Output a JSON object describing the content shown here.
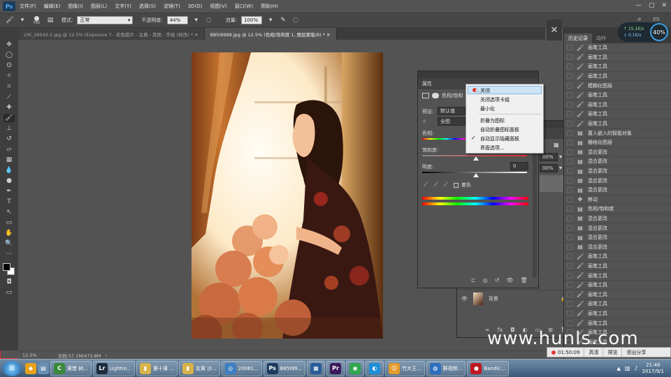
{
  "app": {
    "logo": "Ps",
    "menus": [
      "文件(F)",
      "编辑(E)",
      "图像(I)",
      "图层(L)",
      "文字(Y)",
      "选择(S)",
      "滤镜(T)",
      "3D(D)",
      "视图(V)",
      "窗口(W)",
      "帮助(H)"
    ],
    "window_controls": [
      "—",
      "▢",
      "✕"
    ]
  },
  "options": {
    "brush_size": "700",
    "mode_label": "模式:",
    "mode_value": "正常",
    "opacity_label": "不透明度:",
    "opacity_value": "44%",
    "flow_label": "流量:",
    "flow_value": "100%"
  },
  "tabs": [
    {
      "label": "LYK_29542-2.jpg @ 12.5% (Exposure 7 - 彩色胶片 - 古典 - 其他 - 手绘 (修改) * ✕",
      "active": false
    },
    {
      "label": "B85I9999.jpg @ 12.5% (色相/饱和度 1, 图层蒙版/8) * ✕",
      "active": true
    }
  ],
  "status": {
    "zoom": "12.5%",
    "doc": "文档:57.1M/473.8M"
  },
  "properties": {
    "tab": "属性",
    "adjust_title": "色相/饱和",
    "preset_label": "预设:",
    "preset_value": "默认值",
    "channel_value": "全图",
    "hue_label": "色相:",
    "saturation_label": "饱和度:",
    "lightness_label": "明度:",
    "lightness_value": "0",
    "colorize_label": "着色"
  },
  "context_menu": {
    "items": [
      "关闭",
      "关闭选项卡组",
      "最小化",
      "折叠为图标",
      "自动折叠图标面板",
      "自动显示隐藏面板",
      "界面选项..."
    ],
    "checked": "自动显示隐藏面板"
  },
  "layers": {
    "opacity_value": "00%",
    "fill_value": "00%",
    "background_layer": "背景"
  },
  "history": {
    "tabs": [
      "历史记录",
      "动作"
    ],
    "items": [
      {
        "icon": "brush",
        "label": "画笔工具"
      },
      {
        "icon": "brush",
        "label": "画笔工具"
      },
      {
        "icon": "brush",
        "label": "画笔工具"
      },
      {
        "icon": "brush",
        "label": "画笔工具"
      },
      {
        "icon": "brush",
        "label": "模糊化图层"
      },
      {
        "icon": "brush",
        "label": "画笔工具"
      },
      {
        "icon": "brush",
        "label": "画笔工具"
      },
      {
        "icon": "brush",
        "label": "画笔工具"
      },
      {
        "icon": "brush",
        "label": "画笔工具"
      },
      {
        "icon": "doc",
        "label": "置入嵌入的智能对象"
      },
      {
        "icon": "doc",
        "label": "栅格化图层"
      },
      {
        "icon": "doc",
        "label": "混合更改"
      },
      {
        "icon": "doc",
        "label": "混合更改"
      },
      {
        "icon": "doc",
        "label": "混合更改"
      },
      {
        "icon": "doc",
        "label": "混合更改"
      },
      {
        "icon": "doc",
        "label": "混合更改"
      },
      {
        "icon": "move",
        "label": "移动"
      },
      {
        "icon": "doc",
        "label": "色相/饱和度"
      },
      {
        "icon": "doc",
        "label": "混合更改"
      },
      {
        "icon": "doc",
        "label": "混合更改"
      },
      {
        "icon": "doc",
        "label": "混合更改"
      },
      {
        "icon": "doc",
        "label": "混合更改"
      },
      {
        "icon": "brush",
        "label": "画笔工具"
      },
      {
        "icon": "brush",
        "label": "画笔工具"
      },
      {
        "icon": "brush",
        "label": "画笔工具"
      },
      {
        "icon": "brush",
        "label": "画笔工具"
      },
      {
        "icon": "brush",
        "label": "画笔工具"
      },
      {
        "icon": "brush",
        "label": "画笔工具"
      },
      {
        "icon": "brush",
        "label": "画笔工具"
      },
      {
        "icon": "brush",
        "label": "画笔工具"
      },
      {
        "icon": "brush",
        "label": "画笔工具"
      },
      {
        "icon": "brush",
        "label": "画笔工具"
      }
    ]
  },
  "network": {
    "up": "15.1K/s",
    "down": "0.1K/s",
    "percent": "40%"
  },
  "recorder": {
    "time": "01:50:09",
    "buttons": [
      "高清",
      "预览",
      "退出分享"
    ]
  },
  "watermark": "www.hunls.com",
  "taskbar": {
    "items": [
      {
        "label": "黄晋 树...",
        "color": "#3a8a3a",
        "glyph": "C"
      },
      {
        "label": "Lightro...",
        "color": "#1d2c3c",
        "glyph": "Lr"
      },
      {
        "label": "第十课 ...",
        "color": "#d8b24a",
        "glyph": "▮"
      },
      {
        "label": "玄黄 沙...",
        "color": "#d8b24a",
        "glyph": "▮"
      },
      {
        "label": "20081...",
        "color": "#3d7fc1",
        "glyph": "◎"
      },
      {
        "label": "B85I99...",
        "color": "#1c3a5c",
        "glyph": "Ps"
      },
      {
        "label": "",
        "color": "#2b5c99",
        "glyph": "▦"
      },
      {
        "label": "",
        "color": "#3d1a5c",
        "glyph": "Pr"
      },
      {
        "label": "",
        "color": "#2fa84f",
        "glyph": "◉"
      },
      {
        "label": "",
        "color": "#1e8fd8",
        "glyph": "◐"
      },
      {
        "label": "竹大王...",
        "color": "#e49b2c",
        "glyph": "☺"
      },
      {
        "label": "群视频...",
        "color": "#2c6fbf",
        "glyph": "◍"
      },
      {
        "label": "Bandic...",
        "color": "#c0181f",
        "glyph": "●"
      }
    ],
    "time": "21:49",
    "date": "2017/9/1"
  },
  "colors": {
    "accent_red": "#d33333",
    "panel_bg": "#535353",
    "menu_highlight": "#cde4f7"
  }
}
